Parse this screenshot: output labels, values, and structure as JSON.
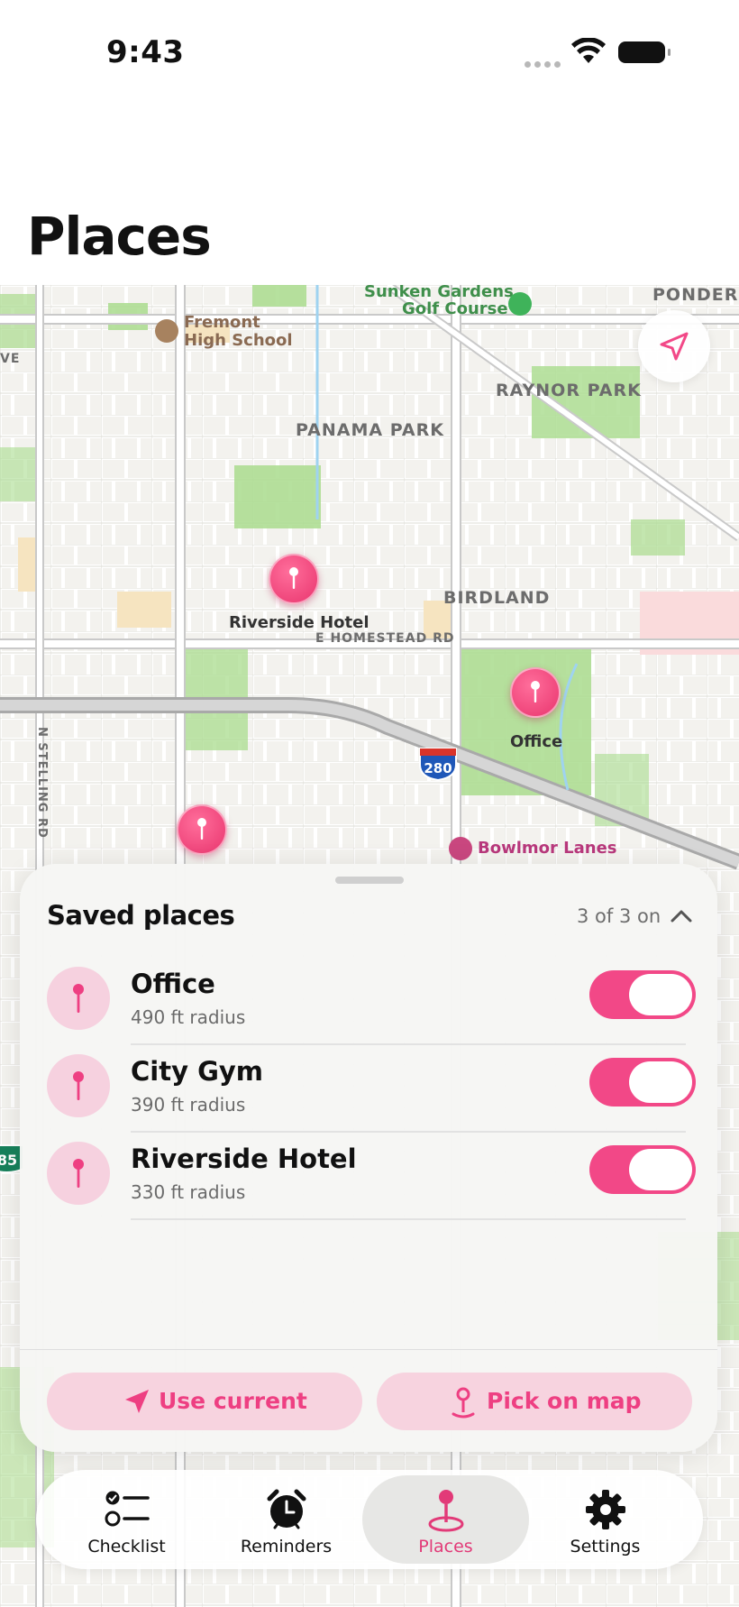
{
  "status_bar": {
    "time": "9:43"
  },
  "page": {
    "title": "Places"
  },
  "map": {
    "labels": {
      "sunken_gardens": "Sunken Gardens",
      "golf_course": "Golf Course",
      "ponderosa": "PONDEROS",
      "fremont": "Fremont",
      "high_school": "High School",
      "ve": "VE",
      "raynor_park": "RAYNOR PARK",
      "panama_park": "PANAMA PARK",
      "birdland": "BIRDLAND",
      "homestead_rd": "E HOMESTEAD RD",
      "stelling_rd": "N STELLING RD",
      "bowlmor": "Bowlmor Lanes",
      "hwy_280": "280",
      "hwy_85": "85"
    },
    "pins": [
      {
        "label": "Riverside Hotel"
      },
      {
        "label": "Office"
      },
      {
        "label": ""
      }
    ],
    "accent_color": "#f24887"
  },
  "sheet": {
    "title": "Saved places",
    "count": "3 of 3 on",
    "places": [
      {
        "name": "Office",
        "radius": "490 ft radius",
        "enabled": true
      },
      {
        "name": "City Gym",
        "radius": "390 ft radius",
        "enabled": true
      },
      {
        "name": "Riverside Hotel",
        "radius": "330 ft radius",
        "enabled": true
      }
    ],
    "actions": {
      "use_current": "Use current",
      "pick_on_map": "Pick on map"
    }
  },
  "tabs": [
    {
      "label": "Checklist",
      "icon": "checklist-icon",
      "active": false
    },
    {
      "label": "Reminders",
      "icon": "alarm-clock-icon",
      "active": false
    },
    {
      "label": "Places",
      "icon": "map-pin-icon",
      "active": true
    },
    {
      "label": "Settings",
      "icon": "gear-icon",
      "active": false
    }
  ]
}
